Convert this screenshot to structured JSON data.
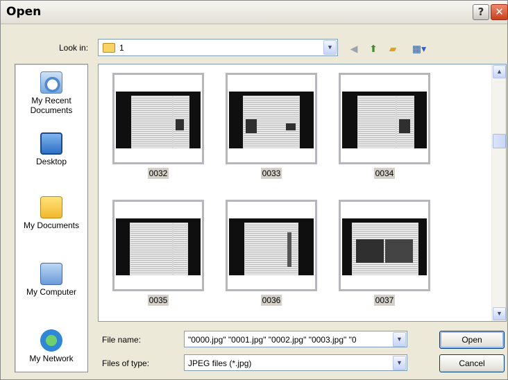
{
  "window": {
    "title": "Open",
    "help_label": "?",
    "close_label": "✕"
  },
  "look_in": {
    "label": "Look in:",
    "value": "1"
  },
  "toolbar": {
    "icons": [
      "back-icon",
      "up-folder-icon",
      "new-folder-icon",
      "views-menu-icon"
    ]
  },
  "places": [
    {
      "name": "recent",
      "label_line1": "My Recent",
      "label_line2": "Documents"
    },
    {
      "name": "desktop",
      "label_line1": "Desktop",
      "label_line2": ""
    },
    {
      "name": "documents",
      "label_line1": "My Documents",
      "label_line2": ""
    },
    {
      "name": "computer",
      "label_line1": "My Computer",
      "label_line2": ""
    },
    {
      "name": "network",
      "label_line1": "My Network",
      "label_line2": ""
    }
  ],
  "files": [
    {
      "name": "0032"
    },
    {
      "name": "0033"
    },
    {
      "name": "0034"
    },
    {
      "name": "0035"
    },
    {
      "name": "0036"
    },
    {
      "name": "0037"
    }
  ],
  "file_name": {
    "label": "File name:",
    "value": "\"0000.jpg\" \"0001.jpg\" \"0002.jpg\" \"0003.jpg\" \"0"
  },
  "file_type": {
    "label": "Files of type:",
    "value": "JPEG files (*.jpg)"
  },
  "buttons": {
    "open": "Open",
    "cancel": "Cancel"
  }
}
